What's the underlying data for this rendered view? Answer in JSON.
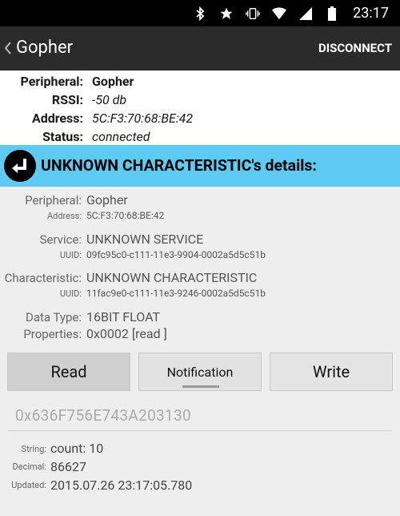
{
  "status_bar": {
    "time": "23:17",
    "icons": [
      "bluetooth-icon",
      "star-icon",
      "vibrate-icon",
      "wifi-icon",
      "signal-icon",
      "battery-icon"
    ]
  },
  "action_bar": {
    "title": "Gopher",
    "disconnect_label": "DISCONNECT"
  },
  "info": {
    "peripheral_label": "Peripheral:",
    "peripheral_value": "Gopher",
    "rssi_label": "RSSI:",
    "rssi_value": "-50 db",
    "address_label": "Address:",
    "address_value": "5C:F3:70:68:BE:42",
    "status_label": "Status:",
    "status_value": "connected"
  },
  "banner": {
    "title": "UNKNOWN CHARACTERISTIC's details:",
    "accent": "#5ecbf5"
  },
  "details": {
    "peripheral_label": "Peripheral:",
    "peripheral_value": "Gopher",
    "address_label": "Address:",
    "address_value": "5C:F3:70:68:BE:42",
    "service_label": "Service:",
    "service_value": "UNKNOWN SERVICE",
    "service_uuid_label": "UUID:",
    "service_uuid_value": "09fc95c0-c111-11e3-9904-0002a5d5c51b",
    "characteristic_label": "Characteristic:",
    "characteristic_value": "UNKNOWN CHARACTERISTIC",
    "char_uuid_label": "UUID:",
    "char_uuid_value": "11fac9e0-c111-11e3-9246-0002a5d5c51b",
    "datatype_label": "Data Type:",
    "datatype_value": "16BIT FLOAT",
    "properties_label": "Properties:",
    "properties_value": "0x0002 [read ]"
  },
  "buttons": {
    "read": "Read",
    "notification": "Notification",
    "write": "Write"
  },
  "hex_value": "0x636F756E743A203130",
  "result": {
    "string_label": "String:",
    "string_value": "count: 10",
    "decimal_label": "Decimal:",
    "decimal_value": "86627",
    "updated_label": "Updated:",
    "updated_value": "2015.07.26 23:17:05.780"
  }
}
